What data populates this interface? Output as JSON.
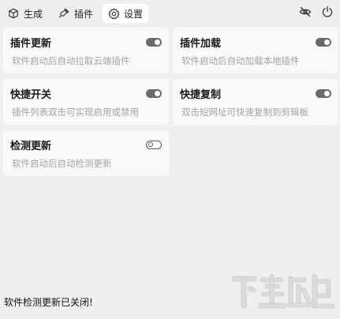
{
  "toolbar": {
    "tabs": [
      {
        "label": "生成",
        "icon": "cube-icon",
        "active": false
      },
      {
        "label": "插件",
        "icon": "plug-icon",
        "active": false
      },
      {
        "label": "设置",
        "icon": "gear-icon",
        "active": true
      }
    ],
    "right_icons": [
      "eye-off-icon",
      "power-icon"
    ]
  },
  "cards": [
    {
      "title": "插件更新",
      "desc": "软件启动后自动拉取云端插件",
      "enabled": true
    },
    {
      "title": "插件加载",
      "desc": "软件启动后自动加载本地插件",
      "enabled": true
    },
    {
      "title": "快捷开关",
      "desc": "插件列表双击可实现启用或禁用",
      "enabled": true
    },
    {
      "title": "快捷复制",
      "desc": "双击短网址可快速复制到剪辑板",
      "enabled": true
    },
    {
      "title": "检测更新",
      "desc": "软件启动后自动检测更新",
      "enabled": false
    }
  ],
  "status": {
    "text": "软件检测更新已关闭!"
  },
  "colors": {
    "background": "#efefef",
    "card": "#f9f9f9",
    "toggle_on": "#6a6a6a",
    "desc_text": "#a3a3a3"
  }
}
